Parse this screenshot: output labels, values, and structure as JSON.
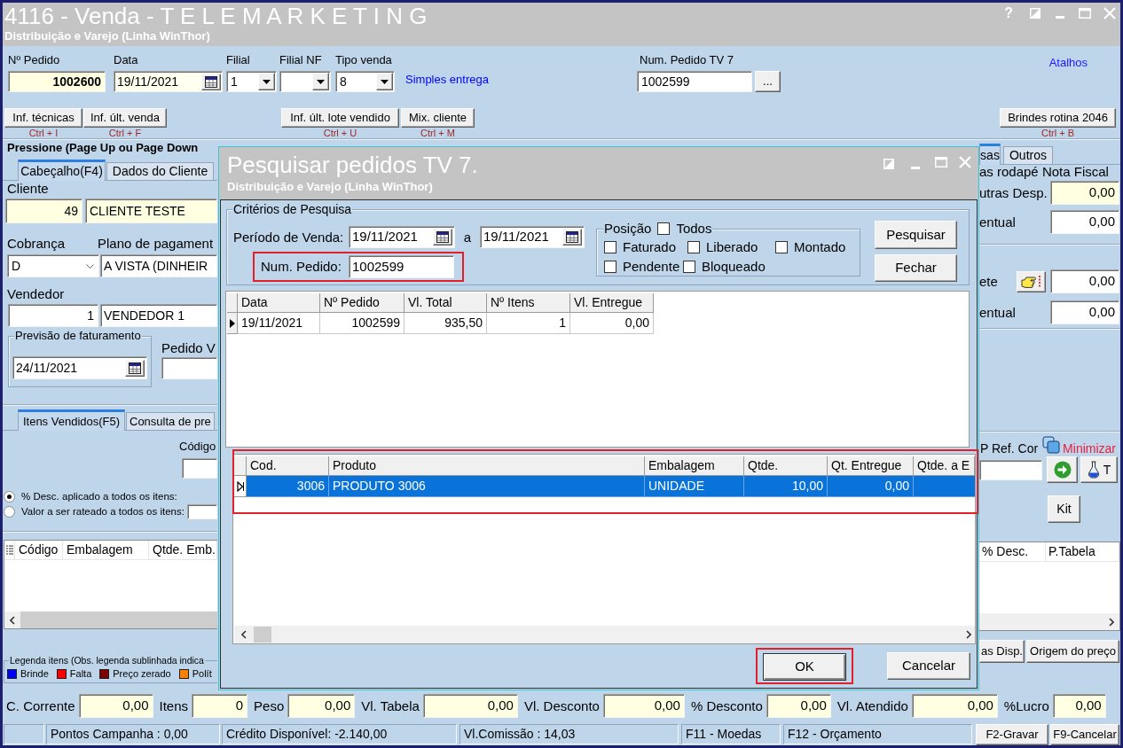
{
  "window": {
    "title": "4116 - Venda - T E L E M A R K E T I N G",
    "subtitle": "Distribuição e Varejo (Linha WinThor)",
    "help": "?"
  },
  "order": {
    "fields": [
      {
        "label": "Nº Pedido",
        "value": "1002600",
        "kind": "number"
      },
      {
        "label": "Data",
        "value": "19/11/2021",
        "kind": "date"
      },
      {
        "label": "Filial",
        "value": "1",
        "kind": "combo"
      },
      {
        "label": "Filial NF",
        "kind": "combo"
      },
      {
        "label": "Tipo venda",
        "value": "8",
        "kind": "combo"
      }
    ],
    "sale_type_name": "Simples entrega",
    "tv7": {
      "label": "Num. Pedido TV 7",
      "value": "1002599",
      "button": "..."
    },
    "shortcuts_link": "Atalhos"
  },
  "tool_buttons": [
    {
      "label": "Inf. técnicas",
      "shortcut": "Ctrl + I"
    },
    {
      "label": "Inf. últ. venda",
      "shortcut": "Ctrl + F"
    },
    {
      "label": "Inf. últ. lote vendido",
      "shortcut": "Ctrl + U"
    },
    {
      "label": "Mix. cliente",
      "shortcut": "Ctrl + M"
    },
    {
      "label": "Brindes rotina 2046",
      "shortcut": "Ctrl + B"
    }
  ],
  "hint": "Pressione (Page Up ou Page Down",
  "header_tabs": [
    {
      "label": "Cabeçalho(F4)",
      "selected": true
    },
    {
      "label": "Dados do Cliente",
      "selected": false
    }
  ],
  "header": {
    "customer": {
      "label": "Cliente",
      "code": "49",
      "name": "CLIENTE TESTE"
    },
    "billing": {
      "label": "Cobrança",
      "value": "D"
    },
    "payment_plan": {
      "label": "Plano de pagament",
      "value": "A VISTA (DINHEIR"
    },
    "seller": {
      "label": "Vendedor",
      "code": "1",
      "name": "VENDEDOR 1"
    },
    "billing_forecast": {
      "label": "Previsão de faturamento",
      "value": "24/11/2021"
    },
    "order_v": {
      "label": "Pedido V"
    }
  },
  "footer_tabs": [
    {
      "label": "sas",
      "selected": true
    },
    {
      "label": "Outros",
      "selected": false
    }
  ],
  "invoice_footer": {
    "title": "as rodapé Nota Fiscal",
    "fields": [
      {
        "label": "utras Desp.",
        "value": "0,00",
        "kind": "readonly"
      },
      {
        "label": "entual",
        "value": "0,00",
        "kind": "input"
      }
    ]
  },
  "freight": {
    "fields": [
      {
        "label": "ete",
        "value": "0,00",
        "kind": "picker"
      },
      {
        "label": "entual",
        "value": "0,00",
        "kind": "input"
      }
    ]
  },
  "items_tabs": [
    {
      "label": "Itens Vendidos(F5)",
      "selected": true
    },
    {
      "label": "Consulta de pre",
      "selected": false
    }
  ],
  "item_entry": {
    "code_label": "Código",
    "ref_label": "P Ref. Cor",
    "minimize": "Minimizar",
    "flask_button": "T",
    "kit_button": "Kit"
  },
  "discount_options": [
    {
      "label": "% Desc. aplicado a todos os itens:",
      "selected": true
    },
    {
      "label": "Valor a ser rateado a todos os itens:",
      "selected": false
    }
  ],
  "items_table": {
    "columns": [
      "Código",
      "Embalagem",
      "Qtde. Emb."
    ],
    "columns_right": [
      "% Desc.",
      "P.Tabela"
    ]
  },
  "item_buttons": [
    "as Disp.",
    "Origem do preço"
  ],
  "legend": {
    "title": "Legenda itens (Obs. legenda sublinhada indica",
    "items": [
      {
        "label": "Brinde",
        "color": "#0000ff"
      },
      {
        "label": "Falta",
        "color": "#ff0000"
      },
      {
        "label": "Preço zerado",
        "color": "#800000"
      },
      {
        "label": "Polít",
        "color": "#ff8000"
      }
    ]
  },
  "totals": [
    {
      "label": "C. Corrente",
      "value": "0,00"
    },
    {
      "label": "Itens",
      "value": "0"
    },
    {
      "label": "Peso",
      "value": "0,00"
    },
    {
      "label": "Vl. Tabela",
      "value": "0,00"
    },
    {
      "label": "Vl. Desconto",
      "value": "0,00"
    },
    {
      "label": "% Desconto",
      "value": "0,00"
    },
    {
      "label": "Vl. Atendido",
      "value": "0,00"
    },
    {
      "label": "%Lucro",
      "value": "0,00"
    }
  ],
  "status_bar": {
    "panels": [
      "Pontos Campanha : 0,00",
      "Crédito Disponível: -2.140,00",
      "Vl.Comissão : 14,03",
      "F11 - Moedas",
      "F12 - Orçamento"
    ],
    "buttons": [
      "F2-Gravar",
      "F9-Cancelar"
    ]
  },
  "dialog": {
    "title": "Pesquisar pedidos TV 7.",
    "subtitle": "Distribuição e Varejo (Linha WinThor)",
    "criteria": {
      "title": "Critérios de Pesquisa",
      "period_label": "Período de Venda:",
      "date_from": "19/11/2021",
      "date_separator": "a",
      "date_to": "19/11/2021",
      "order_label": "Num. Pedido:",
      "order_value": "1002599",
      "order_highlighted": true
    },
    "position": {
      "label": "Posição",
      "all": {
        "label": "Todos",
        "checked": false
      },
      "options": [
        {
          "label": "Faturado",
          "checked": false
        },
        {
          "label": "Liberado",
          "checked": false
        },
        {
          "label": "Montado",
          "checked": false
        },
        {
          "label": "Pendente",
          "checked": false
        },
        {
          "label": "Bloqueado",
          "checked": false
        }
      ]
    },
    "search_buttons": [
      "Pesquisar",
      "Fechar"
    ],
    "orders_table": {
      "columns": [
        "Data",
        "Nº Pedido",
        "Vl. Total",
        "Nº Itens",
        "Vl. Entregue"
      ],
      "rows": [
        {
          "cells": [
            "19/11/2021",
            "1002599",
            "935,50",
            "1",
            "0,00"
          ],
          "selected": true
        }
      ]
    },
    "items_table": {
      "highlighted": true,
      "columns": [
        "Cod.",
        "Produto",
        "Embalagem",
        "Qtde.",
        "Qt. Entregue",
        "Qtde. a E"
      ],
      "rows": [
        {
          "cells": [
            "3006",
            "PRODUTO 3006",
            "UNIDADE",
            "10,00",
            "0,00"
          ],
          "selected": true
        }
      ]
    },
    "footer_buttons": [
      {
        "label": "OK",
        "default": true,
        "highlighted": true
      },
      {
        "label": "Cancelar",
        "default": false,
        "highlighted": false
      }
    ]
  }
}
